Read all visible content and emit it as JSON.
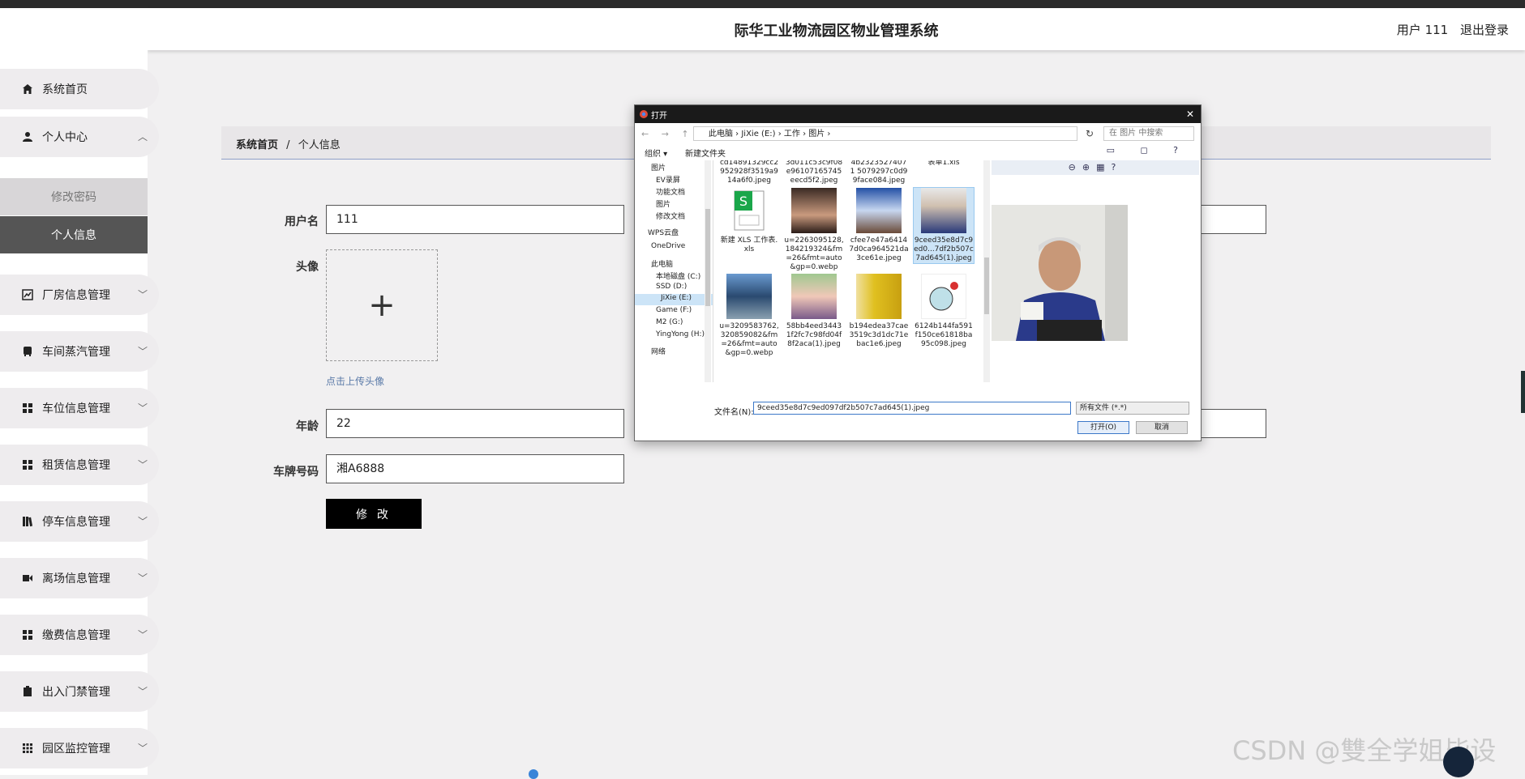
{
  "header": {
    "title": "际华工业物流园区物业管理系统",
    "user_label": "用户 111",
    "logout": "退出登录"
  },
  "sidebar": {
    "items": [
      {
        "label": "系统首页"
      },
      {
        "label": "个人中心"
      },
      {
        "label": "厂房信息管理"
      },
      {
        "label": "车间蒸汽管理"
      },
      {
        "label": "车位信息管理"
      },
      {
        "label": "租赁信息管理"
      },
      {
        "label": "停车信息管理"
      },
      {
        "label": "离场信息管理"
      },
      {
        "label": "缴费信息管理"
      },
      {
        "label": "出入门禁管理"
      },
      {
        "label": "园区监控管理"
      }
    ],
    "sub_items": [
      {
        "label": "修改密码"
      },
      {
        "label": "个人信息"
      }
    ]
  },
  "breadcrumb": {
    "home": "系统首页",
    "sep": "/",
    "current": "个人信息"
  },
  "form": {
    "username_label": "用户名",
    "username": "111",
    "avatar_label": "头像",
    "upload_plus": "+",
    "upload_hint": "点击上传头像",
    "age_label": "年龄",
    "age": "22",
    "plate_label": "车牌号码",
    "plate": "湘A6888",
    "submit": "修 改"
  },
  "dialog": {
    "title": "打开",
    "nav_buttons": "← → ↑",
    "path": "此电脑 › JiXie (E:) › 工作 › 图片 ›",
    "search_placeholder": "在 图片 中搜索",
    "organize": "组织 ▾",
    "new_folder": "新建文件夹",
    "nav_items": [
      {
        "label": "图片"
      },
      {
        "label": "EV录屏"
      },
      {
        "label": "功能文档"
      },
      {
        "label": "图片"
      },
      {
        "label": "修改文档"
      },
      {
        "label": "WPS云盘"
      },
      {
        "label": "OneDrive"
      },
      {
        "label": "此电脑"
      },
      {
        "label": "本地磁盘 (C:)"
      },
      {
        "label": "SSD (D:)"
      },
      {
        "label": "JiXie (E:)"
      },
      {
        "label": "Game (F:)"
      },
      {
        "label": "M2 (G:)"
      },
      {
        "label": "YingYong (H:)"
      },
      {
        "label": "网络"
      }
    ],
    "files": [
      {
        "name": "cd14891329cc2952928f3519a914a6f0.jpeg"
      },
      {
        "name": "3d011c53c9f08e96107165745eecd5f2.jpeg"
      },
      {
        "name": "4b23235274071 5079297c0d99face084.jpeg"
      },
      {
        "name": "表单1.xls"
      },
      {
        "name": "新建 XLS 工作表.xls"
      },
      {
        "name": "u=2263095128,184219324&fm=26&fmt=auto&gp=0.webp"
      },
      {
        "name": "cfee7e47a64147d0ca964521da3ce61e.jpeg"
      },
      {
        "name": "9ceed35e8d7c9ed0...7df2b507c7ad645(1).jpeg"
      },
      {
        "name": "u=3209583762,320859082&fm=26&fmt=auto&gp=0.webp"
      },
      {
        "name": "58bb4eed34431f2fc7c98fd04f8f2aca(1).jpeg"
      },
      {
        "name": "b194edea37cae3519c3d1dc71ebac1e6.jpeg"
      },
      {
        "name": "6124b144fa591f150ce61818ba95c098.jpeg"
      }
    ],
    "filename_label": "文件名(N):",
    "filename": "9ceed35e8d7c9ed097df2b507c7ad645(1).jpeg",
    "filetype": "所有文件 (*.*)",
    "open": "打开(O)",
    "cancel": "取消"
  },
  "watermark": "CSDN @雙全学姐毕设"
}
